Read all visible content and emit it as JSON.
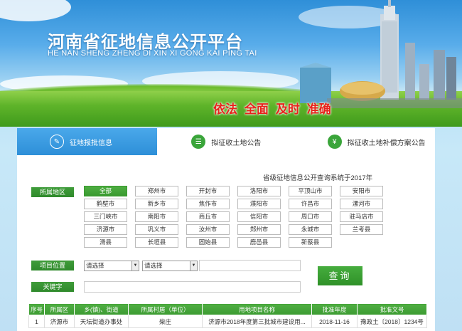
{
  "header": {
    "title_cn": "河南省征地信息公开平台",
    "title_en": "HE NAN SHENG ZHENG DI XIN XI GONG KAI PING TAI",
    "slogan": "依法 全面 及时 准确"
  },
  "tabs": [
    {
      "label": "征地报批信息",
      "icon": "document-icon",
      "active": true
    },
    {
      "label": "拟征收土地公告",
      "icon": "list-icon",
      "active": false
    },
    {
      "label": "拟征收土地补偿方案公告",
      "icon": "money-icon",
      "active": false
    }
  ],
  "notice": "省级征地信息公开查询系统于2017年",
  "filters": {
    "region_label": "所属地区",
    "location_label": "项目位置",
    "keyword_label": "关键字",
    "regions": [
      "全部",
      "郑州市",
      "开封市",
      "洛阳市",
      "平顶山市",
      "安阳市",
      "鹤壁市",
      "新乡市",
      "焦作市",
      "濮阳市",
      "许昌市",
      "漯河市",
      "三门峡市",
      "南阳市",
      "商丘市",
      "信阳市",
      "周口市",
      "驻马店市",
      "济源市",
      "巩义市",
      "汝州市",
      "郑州市",
      "永城市",
      "兰考县",
      "滑县",
      "长垣县",
      "固始县",
      "鹿邑县",
      "新蔡县"
    ],
    "selected_region": "全部",
    "select1": "请选择",
    "select2": "请选择",
    "location_value": "",
    "keyword_value": "",
    "query_button": "查询"
  },
  "table": {
    "headers": [
      "序号",
      "所属区",
      "乡(镇)、街道",
      "所属村居（单位）",
      "用地项目名称",
      "批准年度",
      "批准文号"
    ],
    "rows": [
      [
        "1",
        "济源市",
        "天坛街道办事处",
        "柴庄",
        "济源市2018年度第三批城市建设用...",
        "2018-11-16",
        "豫政土〔2018〕1234号"
      ]
    ]
  },
  "colors": {
    "accent_blue": "#2d8fd8",
    "accent_green": "#3a9a30",
    "slogan_red": "#e8221b"
  }
}
